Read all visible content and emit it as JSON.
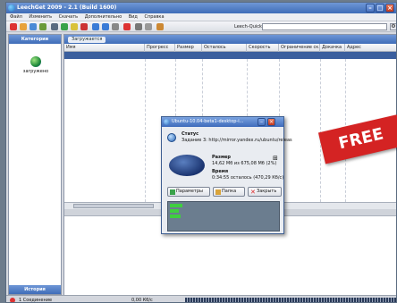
{
  "window": {
    "title": "LeechGet 2009 - 2.1 (Build 1600)"
  },
  "menu": [
    "Файл",
    "Изменить",
    "Скачать",
    "Дополнительно",
    "Вид",
    "Справка"
  ],
  "toolbar": {
    "quick_label": "Leech-Quick-bar:",
    "quick_value": ""
  },
  "sidebar": {
    "header": "Категории",
    "item": "загружено",
    "footer": "История"
  },
  "main": {
    "tab": "Загружается",
    "columns": [
      "Имя",
      "Прогресс",
      "Размер",
      "Осталось",
      "Скорость",
      "Ограничение ск...",
      "Докачка",
      "Адрес"
    ]
  },
  "statusbar": {
    "connections": "1 Соединение",
    "speed": "0,00 Кб/с"
  },
  "dialog": {
    "title": "Ubuntu-10.04-beta1-desktop-i...",
    "status_label": "Статус",
    "status_text": "Задание 3: http://mirror.yandex.ru/ubuntu/releas",
    "size_label": "Размер",
    "size_text": "14,62 Мб из 675,08 Мб (2%)",
    "time_label": "Время",
    "time_text": "0:34:55 осталось (470,29 Кб/с)",
    "btn_params": "Параметры",
    "btn_folder": "Папка",
    "btn_close": "Закрыть"
  },
  "overlay": {
    "badge": "FREE"
  },
  "colors": {
    "accent": "#3f6db8",
    "badge": "#d42323",
    "segment_done": "#3fcf3f"
  }
}
